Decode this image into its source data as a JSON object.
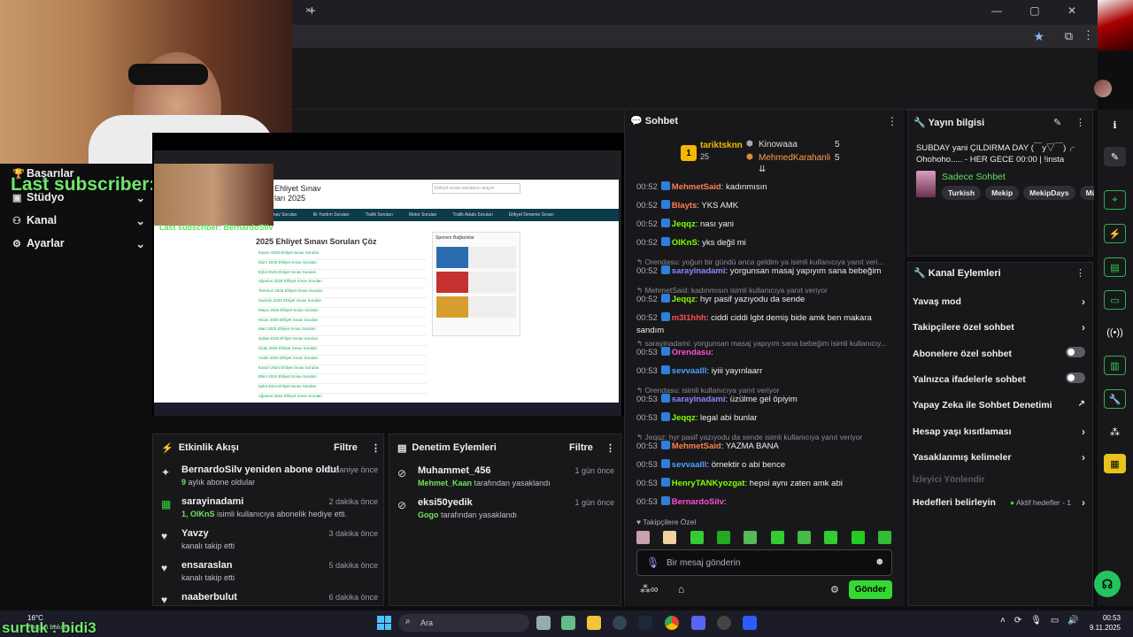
{
  "browser": {
    "new_tab": "+",
    "close_tab": "×",
    "window_controls": "—  ▢  ✕"
  },
  "overlay": {
    "last_subscriber": "Last subscriber: BernardoSilv",
    "subtitle": "surtuk : bidi3"
  },
  "left_menu": [
    {
      "icon": "trophy-icon",
      "label": "Başarılar",
      "chevron": false
    },
    {
      "icon": "studio-icon",
      "label": "Stüdyo",
      "chevron": true
    },
    {
      "icon": "channel-icon",
      "label": "Kanal",
      "chevron": true
    },
    {
      "icon": "gear-icon",
      "label": "Ayarlar",
      "chevron": true
    }
  ],
  "stream": {
    "inner_title": "Ehliyet Sınav\nları 2025",
    "inner_search_placeholder": "Ehliyet sınavı sorularını arayın",
    "inner_nav": [
      "Sınav Soruları",
      "İlk Yardım Soruları",
      "Trafik Soruları",
      "Motor Soruları",
      "Trafik Adabı Soruları",
      "Ehliyet Deneme Sınavı"
    ],
    "inner_heading": "2025 Ehliyet Sınavı Soruları Çöz",
    "inner_list": [
      "Kasım 2025 Ehliyet Sınav Soruları",
      "Ekim 2025 Ehliyet Sınav Soruları",
      "Eylül 2025 Ehliyet Sınav Soruları",
      "Ağustos 2025 Ehliyet Sınav Soruları",
      "Temmuz 2025 Ehliyet Sınav Soruları",
      "Haziran 2025 Ehliyet Sınav Soruları",
      "Mayıs 2025 Ehliyet Sınav Soruları",
      "Nisan 2025 Ehliyet Sınav Soruları",
      "Mart 2025 Ehliyet Sınav Soruları",
      "Şubat 2025 Ehliyet Sınav Soruları",
      "Ocak 2025 Ehliyet Sınav Soruları",
      "Aralık 2024 Ehliyet Sınav Soruları",
      "Kasım 2024 Ehliyet Sınav Soruları",
      "Ekim 2024 Ehliyet Sınav Soruları",
      "Eylül 2024 Ehliyet Sınav Soruları",
      "Ağustos 2024 Ehliyet Sınav Soruları"
    ],
    "inner_overlay": "Last subscriber: BernardoSilv",
    "sponsor_heading": "Sponsor Bağlantılar"
  },
  "activity": {
    "title": "Etkinlik Akışı",
    "filter": "Filtre",
    "items": [
      {
        "icon": "sparkle-icon",
        "title": "BernardoSilv yeniden abone oldu!",
        "sub_hl": "9",
        "sub": " aylık abone oldular",
        "time": "13 saniye önce"
      },
      {
        "icon": "gift-icon",
        "title": "sarayinadami",
        "sub_hl": "1, OlKnS",
        "sub": " isimli kullanıcıya abonelik hediye etti.",
        "time": "2 dakika önce"
      },
      {
        "icon": "heart-icon",
        "title": "Yavzy",
        "sub_hl": "",
        "sub": "kanalı takip etti",
        "time": "3 dakika önce"
      },
      {
        "icon": "heart-icon",
        "title": "ensaraslan",
        "sub_hl": "",
        "sub": "kanalı takip etti",
        "time": "5 dakika önce"
      },
      {
        "icon": "heart-icon",
        "title": "naaberbulut",
        "sub_hl": "",
        "sub": "",
        "time": "6 dakika önce"
      }
    ]
  },
  "moderation": {
    "title": "Denetim Eylemleri",
    "filter": "Filtre",
    "items": [
      {
        "title": "Muhammet_456",
        "sub_hl": "Mehmet_Kaan",
        "sub": " tarafından yasaklandı",
        "time": "1 gün önce"
      },
      {
        "title": "eksi50yedik",
        "sub_hl": "Gogo",
        "sub": " tarafından yasaklandı",
        "time": "1 gün önce"
      }
    ]
  },
  "chat": {
    "title": "Sohbet",
    "leaderboard": {
      "first": {
        "rank": "1",
        "name": "tariktsknn",
        "count": "25"
      },
      "second": {
        "name": "Kinowaaa",
        "count": "5"
      },
      "third": {
        "name": "MehmedKarahanli",
        "count": "5"
      }
    },
    "lines": [
      {
        "type": "msg",
        "time": "00:52",
        "user": "MehmetSaid",
        "color": "#ff7f50",
        "text": "kadınmısın"
      },
      {
        "type": "msg",
        "time": "00:52",
        "user": "Blayts",
        "color": "#ff7f50",
        "text": "YKS AMK"
      },
      {
        "type": "msg",
        "time": "00:52",
        "user": "Jeqqz",
        "color": "#7fff00",
        "text": "nası yani"
      },
      {
        "type": "msg",
        "time": "00:52",
        "user": "OlKnS",
        "color": "#7fff00",
        "text": "yks değil mi"
      },
      {
        "type": "reply",
        "text": "Orendasu: yoğun bir gündü anca geldim ya isimli kullanıcıya yanıt veri..."
      },
      {
        "type": "msg",
        "time": "00:52",
        "user": "sarayinadami",
        "color": "#8a8aff",
        "text": "yorgunsan masaj yapıyım sana bebeğim"
      },
      {
        "type": "reply",
        "text": "MehmetSaid: kadınmısın isimli kullanıcıya yanıt veriyor"
      },
      {
        "type": "msg",
        "time": "00:52",
        "user": "Jeqqz",
        "color": "#7fff00",
        "text": "hyr pasif yazıyodu da sende"
      },
      {
        "type": "msg",
        "time": "00:52",
        "user": "m3l1hhh",
        "color": "#ff5050",
        "text": "ciddi ciddi lgbt demiş bide amk ben makara sandım"
      },
      {
        "type": "reply",
        "text": "sarayinadami: yorgunsan masaj yapıyım sana bebeğim isimli kullanıcıy..."
      },
      {
        "type": "msg",
        "time": "00:53",
        "user": "Orendasu",
        "color": "#ff4fd8",
        "text": ""
      },
      {
        "type": "msg",
        "time": "00:53",
        "user": "sevvaalll",
        "color": "#4f9fff",
        "text": "iyiii yayınlaarr"
      },
      {
        "type": "reply",
        "text": "Orendasu:       isimli kullanıcıya yanıt veriyor"
      },
      {
        "type": "msg",
        "time": "00:53",
        "user": "sarayinadami",
        "color": "#8a8aff",
        "text": "üzülme gel öpiyim"
      },
      {
        "type": "msg",
        "time": "00:53",
        "user": "Jeqqz",
        "color": "#7fff00",
        "text": "legal abi bunlar"
      },
      {
        "type": "reply",
        "text": "Jeqqz: hyr pasif yazıyodu da sende isimli kullanıcıya yanıt veriyor"
      },
      {
        "type": "msg",
        "time": "00:53",
        "user": "MehmetSaid",
        "color": "#ff7f50",
        "text": "YAZMA BANA"
      },
      {
        "type": "msg",
        "time": "00:53",
        "user": "sevvaalll",
        "color": "#4f9fff",
        "text": "örnektir o abi bence"
      },
      {
        "type": "msg",
        "time": "00:53",
        "user": "HenryTANKyozgat",
        "color": "#7fff00",
        "text": "hepsi aynı zaten amk abi"
      },
      {
        "type": "msg",
        "time": "00:53",
        "user": "BernardoSilv",
        "color": "#ff4fd8",
        "text": ""
      }
    ],
    "followers_only": "Takipçilere Özel",
    "input_placeholder": "Bir mesaj gönderin",
    "send": "Gönder"
  },
  "stream_info": {
    "title": "Yayın bilgisi",
    "description": "SUBDAY yani ÇILDIRMA DAY (￣y▽￣)╭ Ohohoho..... - HER GECE 00:00 | !insta",
    "category": "Sadece Sohbet",
    "tags": [
      "Turkish",
      "Mekip",
      "MekipDays",
      "Mü"
    ]
  },
  "channel_actions": {
    "title": "Kanal Eylemleri",
    "rows": [
      {
        "label": "Yavaş mod",
        "kind": "arrow"
      },
      {
        "label": "Takipçilere özel sohbet",
        "kind": "arrow"
      },
      {
        "label": "Abonelere özel sohbet",
        "kind": "toggle"
      },
      {
        "label": "Yalnızca ifadelerle sohbet",
        "kind": "toggle"
      },
      {
        "label": "Yapay Zeka ile Sohbet Denetimi",
        "kind": "external"
      },
      {
        "label": "Hesap yaşı kısıtlaması",
        "kind": "arrow"
      },
      {
        "label": "Yasaklanmış kelimeler",
        "kind": "arrow"
      }
    ],
    "section": "İzleyici Yönlendir",
    "goals_label": "Hedefleri belirleyin",
    "goals_status": "Aktif hedefler - 1"
  },
  "taskbar": {
    "weather": "16°C",
    "weather_sub": "Parçalı bulutlu",
    "search": "Ara",
    "time": "00:53",
    "date": "9.11.2025"
  },
  "colors": {
    "accent_green": "#33d933",
    "bg": "#0e0e10",
    "panel": "#18181b"
  }
}
